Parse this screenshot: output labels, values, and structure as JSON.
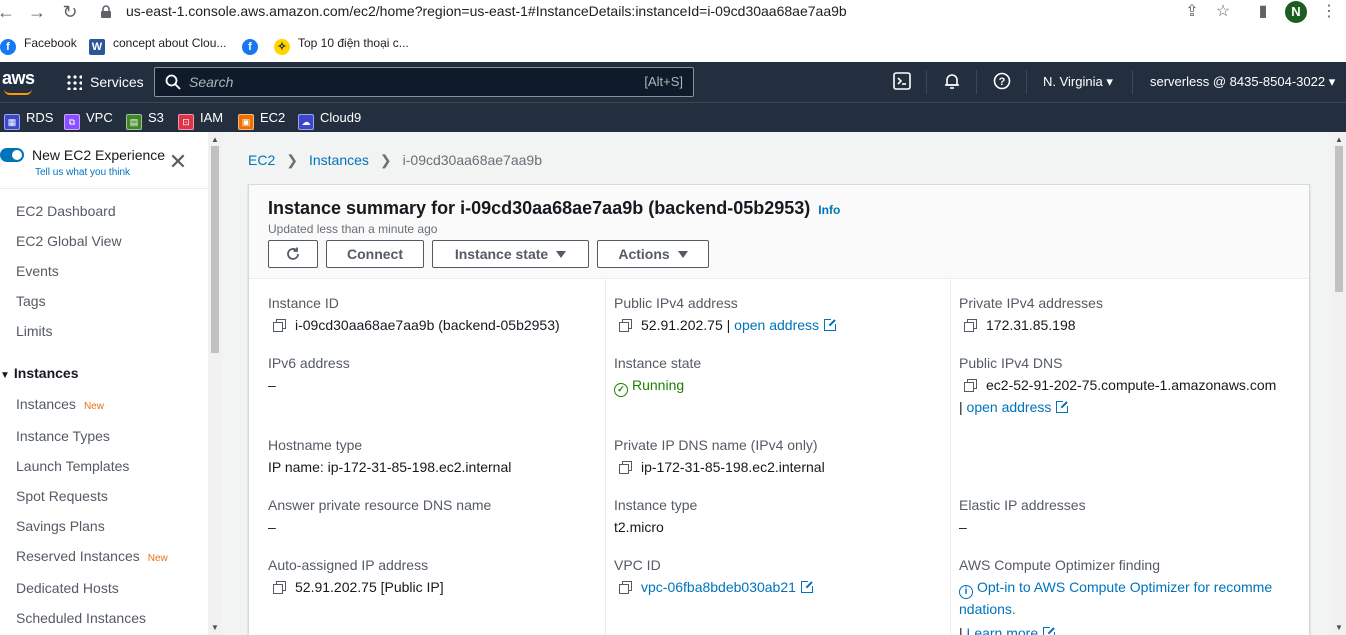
{
  "browser": {
    "url": "us-east-1.console.aws.amazon.com/ec2/home?region=us-east-1#InstanceDetails:instanceId=i-09cd30aa68ae7aa9b",
    "avatar_letter": "N",
    "bookmarks": [
      {
        "label": "Facebook",
        "icon": "facebook-icon",
        "color": "#1877f2"
      },
      {
        "label": "concept about Clou...",
        "icon": "word-icon",
        "color": "#2b579a"
      },
      {
        "label": "",
        "icon": "facebook-icon",
        "color": "#1877f2"
      },
      {
        "label": "Top 10 điện thoại c...",
        "icon": "thegioididong-icon",
        "color": "#ffd400"
      }
    ]
  },
  "aws_header": {
    "logo": "aws",
    "services": "Services",
    "search_placeholder": "Search",
    "search_hint": "[Alt+S]",
    "region": "N. Virginia",
    "account": "serverless @ 8435-8504-3022"
  },
  "favorites": [
    {
      "label": "RDS",
      "color": "#3b48cc"
    },
    {
      "label": "VPC",
      "color": "#8c4fff"
    },
    {
      "label": "S3",
      "color": "#3f8624"
    },
    {
      "label": "IAM",
      "color": "#dd344c"
    },
    {
      "label": "EC2",
      "color": "#ed7100"
    },
    {
      "label": "Cloud9",
      "color": "#3b48cc"
    }
  ],
  "sidebar": {
    "toggle_label": "New EC2 Experience",
    "toggle_sub": "Tell us what you think",
    "items_top": [
      "EC2 Dashboard",
      "EC2 Global View",
      "Events",
      "Tags",
      "Limits"
    ],
    "section": "Instances",
    "new_badge": "New",
    "instances_items": [
      "Instances",
      "Instance Types",
      "Launch Templates",
      "Spot Requests",
      "Savings Plans",
      "Reserved Instances",
      "Dedicated Hosts",
      "Scheduled Instances"
    ]
  },
  "breadcrumb": {
    "root": "EC2",
    "level1": "Instances",
    "current": "i-09cd30aa68ae7aa9b"
  },
  "summary": {
    "title": "Instance summary for i-09cd30aa68ae7aa9b (backend-05b2953)",
    "info": "Info",
    "updated": "Updated less than a minute ago",
    "connect": "Connect",
    "instance_state_btn": "Instance state",
    "actions_btn": "Actions"
  },
  "fields": {
    "instance_id_label": "Instance ID",
    "instance_id": "i-09cd30aa68ae7aa9b (backend-05b2953)",
    "public_ipv4_label": "Public IPv4 address",
    "public_ipv4": "52.91.202.75",
    "open_address": "open address",
    "private_ipv4_label": "Private IPv4 addresses",
    "private_ipv4": "172.31.85.198",
    "ipv6_label": "IPv6 address",
    "ipv6": "–",
    "state_label": "Instance state",
    "state": "Running",
    "public_dns_label": "Public IPv4 DNS",
    "public_dns": "ec2-52-91-202-75.compute-1.amazonaws.com",
    "hostname_type_label": "Hostname type",
    "hostname_type": "IP name: ip-172-31-85-198.ec2.internal",
    "private_dns_label": "Private IP DNS name (IPv4 only)",
    "private_dns": "ip-172-31-85-198.ec2.internal",
    "answer_dns_label": "Answer private resource DNS name",
    "answer_dns": "–",
    "instance_type_label": "Instance type",
    "instance_type": "t2.micro",
    "elastic_ip_label": "Elastic IP addresses",
    "elastic_ip": "–",
    "auto_ip_label": "Auto-assigned IP address",
    "auto_ip": "52.91.202.75 [Public IP]",
    "vpc_label": "VPC ID",
    "vpc": "vpc-06fba8bdeb030ab21",
    "optimizer_label": "AWS Compute Optimizer finding",
    "optimizer_line1": "Opt-in to AWS Compute Optimizer for recomme",
    "optimizer_line2": "ndations.",
    "learn_more": "Learn more"
  }
}
